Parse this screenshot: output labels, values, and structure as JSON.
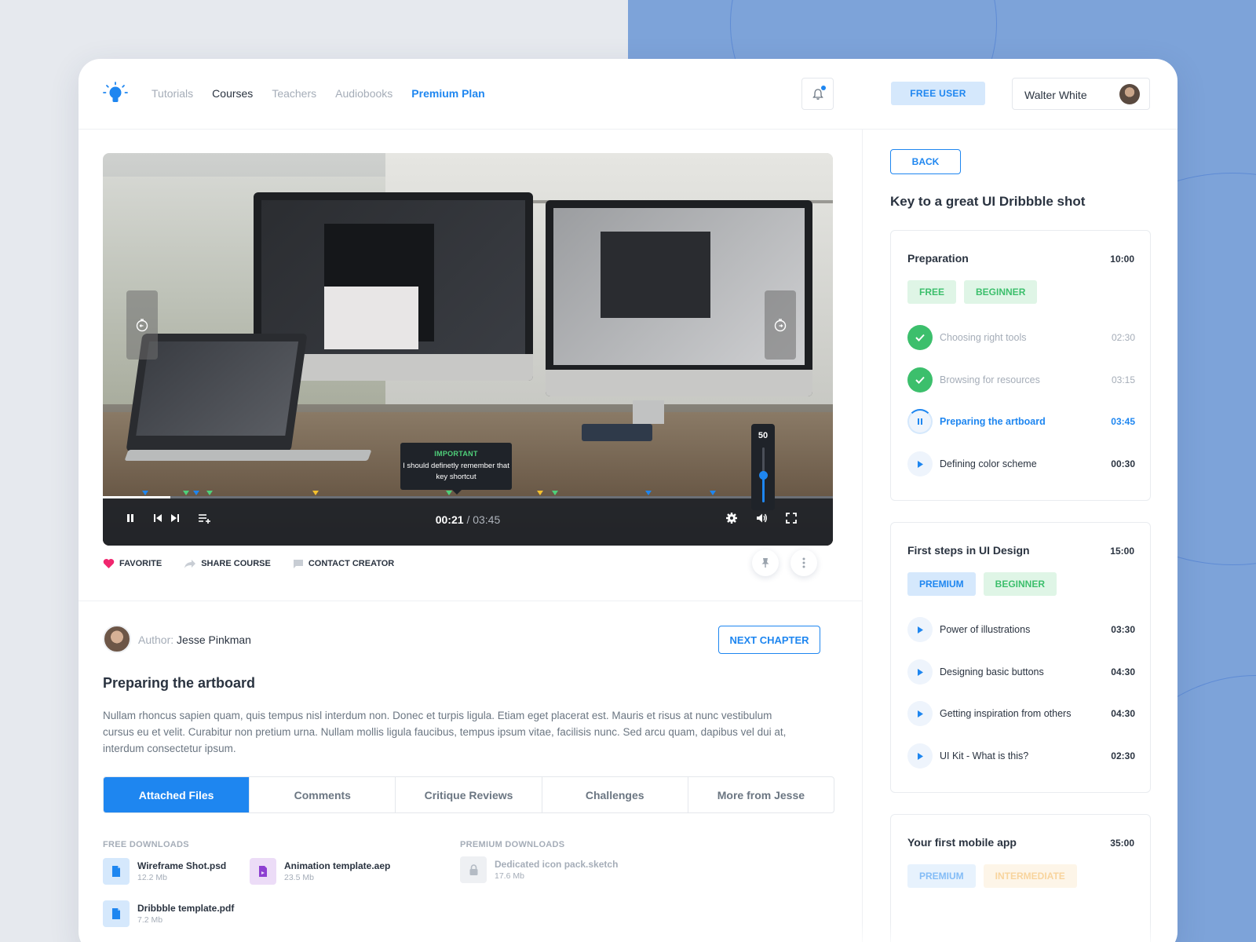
{
  "nav": {
    "links": [
      "Tutorials",
      "Courses",
      "Teachers",
      "Audiobooks",
      "Premium Plan"
    ],
    "plan_badge": "FREE USER",
    "user_name": "Walter White"
  },
  "video": {
    "tooltip_title": "IMPORTANT",
    "tooltip_body": "I should definetly remember that key shortcut",
    "volume": "50",
    "volume_level": 0.5,
    "current_time": "00:21",
    "duration": "/ 03:45",
    "progress": 0.093
  },
  "actions": {
    "favorite": "FAVORITE",
    "share": "SHARE COURSE",
    "contact": "CONTACT CREATOR"
  },
  "lesson": {
    "author_label": "Author:",
    "author_name": "Jesse Pinkman",
    "next_button": "NEXT CHAPTER",
    "title": "Preparing the artboard",
    "description": "Nullam rhoncus sapien quam, quis tempus nisl interdum non. Donec et turpis ligula. Etiam eget placerat est. Mauris et risus at nunc vestibulum cursus eu et velit. Curabitur non pretium urna. Nullam mollis ligula faucibus, tempus ipsum vitae, facilisis nunc. Sed arcu quam, dapibus vel dui at, interdum consectetur ipsum."
  },
  "tabs": [
    "Attached Files",
    "Comments",
    "Critique Reviews",
    "Challenges",
    "More from Jesse"
  ],
  "downloads": {
    "free_heading": "FREE DOWNLOADS",
    "premium_heading": "PREMIUM DOWNLOADS",
    "free": [
      {
        "name": "Wireframe Shot.psd",
        "size": "12.2 Mb"
      },
      {
        "name": "Animation template.aep",
        "size": "23.5 Mb"
      },
      {
        "name": "Dribbble template.pdf",
        "size": "7.2 Mb"
      }
    ],
    "premium": [
      {
        "name": "Dedicated icon pack.sketch",
        "size": "17.6 Mb"
      }
    ]
  },
  "sidebar": {
    "back": "BACK",
    "course_title": "Key to a great UI Dribbble shot",
    "sections": [
      {
        "title": "Preparation",
        "time": "10:00",
        "tags": [
          "FREE",
          "BEGINNER"
        ],
        "items": [
          {
            "label": "Choosing right tools",
            "time": "02:30"
          },
          {
            "label": "Browsing for resources",
            "time": "03:15"
          },
          {
            "label": "Preparing the artboard",
            "time": "03:45"
          },
          {
            "label": "Defining color scheme",
            "time": "00:30"
          }
        ]
      },
      {
        "title": "First steps in UI Design",
        "time": "15:00",
        "tags": [
          "PREMIUM",
          "BEGINNER"
        ],
        "items": [
          {
            "label": "Power of illustrations",
            "time": "03:30"
          },
          {
            "label": "Designing basic buttons",
            "time": "04:30"
          },
          {
            "label": "Getting inspiration from others",
            "time": "04:30"
          },
          {
            "label": "UI Kit - What is this?",
            "time": "02:30"
          }
        ]
      },
      {
        "title": "Your first mobile app",
        "time": "35:00",
        "tags": [
          "PREMIUM",
          "INTERMEDIATE"
        ]
      }
    ]
  },
  "colors": {
    "accent": "#1e86f0",
    "success": "#3cbf6c",
    "favorite": "#f0266e"
  }
}
